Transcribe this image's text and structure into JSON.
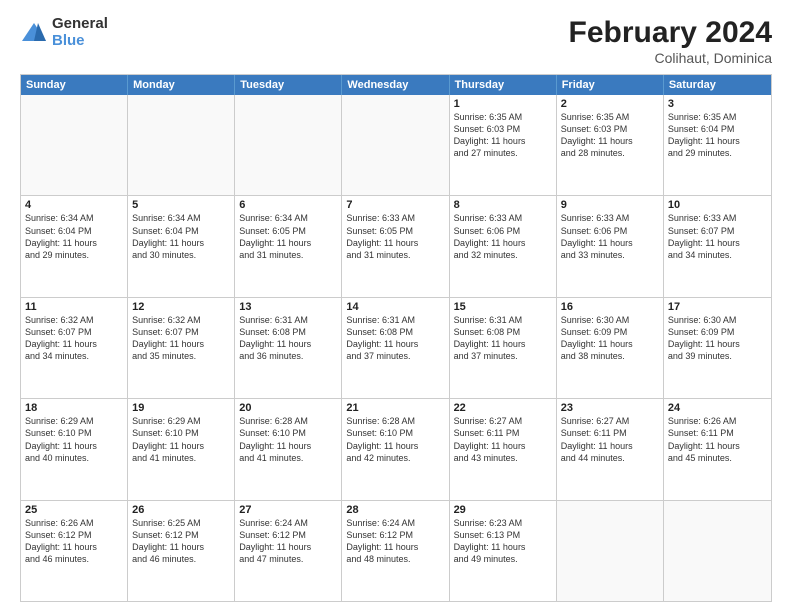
{
  "header": {
    "logo_general": "General",
    "logo_blue": "Blue",
    "title": "February 2024",
    "location": "Colihaut, Dominica"
  },
  "weekdays": [
    "Sunday",
    "Monday",
    "Tuesday",
    "Wednesday",
    "Thursday",
    "Friday",
    "Saturday"
  ],
  "rows": [
    [
      {
        "day": "",
        "empty": true
      },
      {
        "day": "",
        "empty": true
      },
      {
        "day": "",
        "empty": true
      },
      {
        "day": "",
        "empty": true
      },
      {
        "day": "1",
        "sunrise": "6:35 AM",
        "sunset": "6:03 PM",
        "daylight": "11 hours and 27 minutes."
      },
      {
        "day": "2",
        "sunrise": "6:35 AM",
        "sunset": "6:03 PM",
        "daylight": "11 hours and 28 minutes."
      },
      {
        "day": "3",
        "sunrise": "6:35 AM",
        "sunset": "6:04 PM",
        "daylight": "11 hours and 29 minutes."
      }
    ],
    [
      {
        "day": "4",
        "sunrise": "6:34 AM",
        "sunset": "6:04 PM",
        "daylight": "11 hours and 29 minutes."
      },
      {
        "day": "5",
        "sunrise": "6:34 AM",
        "sunset": "6:04 PM",
        "daylight": "11 hours and 30 minutes."
      },
      {
        "day": "6",
        "sunrise": "6:34 AM",
        "sunset": "6:05 PM",
        "daylight": "11 hours and 31 minutes."
      },
      {
        "day": "7",
        "sunrise": "6:33 AM",
        "sunset": "6:05 PM",
        "daylight": "11 hours and 31 minutes."
      },
      {
        "day": "8",
        "sunrise": "6:33 AM",
        "sunset": "6:06 PM",
        "daylight": "11 hours and 32 minutes."
      },
      {
        "day": "9",
        "sunrise": "6:33 AM",
        "sunset": "6:06 PM",
        "daylight": "11 hours and 33 minutes."
      },
      {
        "day": "10",
        "sunrise": "6:33 AM",
        "sunset": "6:07 PM",
        "daylight": "11 hours and 34 minutes."
      }
    ],
    [
      {
        "day": "11",
        "sunrise": "6:32 AM",
        "sunset": "6:07 PM",
        "daylight": "11 hours and 34 minutes."
      },
      {
        "day": "12",
        "sunrise": "6:32 AM",
        "sunset": "6:07 PM",
        "daylight": "11 hours and 35 minutes."
      },
      {
        "day": "13",
        "sunrise": "6:31 AM",
        "sunset": "6:08 PM",
        "daylight": "11 hours and 36 minutes."
      },
      {
        "day": "14",
        "sunrise": "6:31 AM",
        "sunset": "6:08 PM",
        "daylight": "11 hours and 37 minutes."
      },
      {
        "day": "15",
        "sunrise": "6:31 AM",
        "sunset": "6:08 PM",
        "daylight": "11 hours and 37 minutes."
      },
      {
        "day": "16",
        "sunrise": "6:30 AM",
        "sunset": "6:09 PM",
        "daylight": "11 hours and 38 minutes."
      },
      {
        "day": "17",
        "sunrise": "6:30 AM",
        "sunset": "6:09 PM",
        "daylight": "11 hours and 39 minutes."
      }
    ],
    [
      {
        "day": "18",
        "sunrise": "6:29 AM",
        "sunset": "6:10 PM",
        "daylight": "11 hours and 40 minutes."
      },
      {
        "day": "19",
        "sunrise": "6:29 AM",
        "sunset": "6:10 PM",
        "daylight": "11 hours and 41 minutes."
      },
      {
        "day": "20",
        "sunrise": "6:28 AM",
        "sunset": "6:10 PM",
        "daylight": "11 hours and 41 minutes."
      },
      {
        "day": "21",
        "sunrise": "6:28 AM",
        "sunset": "6:10 PM",
        "daylight": "11 hours and 42 minutes."
      },
      {
        "day": "22",
        "sunrise": "6:27 AM",
        "sunset": "6:11 PM",
        "daylight": "11 hours and 43 minutes."
      },
      {
        "day": "23",
        "sunrise": "6:27 AM",
        "sunset": "6:11 PM",
        "daylight": "11 hours and 44 minutes."
      },
      {
        "day": "24",
        "sunrise": "6:26 AM",
        "sunset": "6:11 PM",
        "daylight": "11 hours and 45 minutes."
      }
    ],
    [
      {
        "day": "25",
        "sunrise": "6:26 AM",
        "sunset": "6:12 PM",
        "daylight": "11 hours and 46 minutes."
      },
      {
        "day": "26",
        "sunrise": "6:25 AM",
        "sunset": "6:12 PM",
        "daylight": "11 hours and 46 minutes."
      },
      {
        "day": "27",
        "sunrise": "6:24 AM",
        "sunset": "6:12 PM",
        "daylight": "11 hours and 47 minutes."
      },
      {
        "day": "28",
        "sunrise": "6:24 AM",
        "sunset": "6:12 PM",
        "daylight": "11 hours and 48 minutes."
      },
      {
        "day": "29",
        "sunrise": "6:23 AM",
        "sunset": "6:13 PM",
        "daylight": "11 hours and 49 minutes."
      },
      {
        "day": "",
        "empty": true
      },
      {
        "day": "",
        "empty": true
      }
    ]
  ],
  "labels": {
    "sunrise": "Sunrise:",
    "sunset": "Sunset:",
    "daylight": "Daylight:"
  }
}
